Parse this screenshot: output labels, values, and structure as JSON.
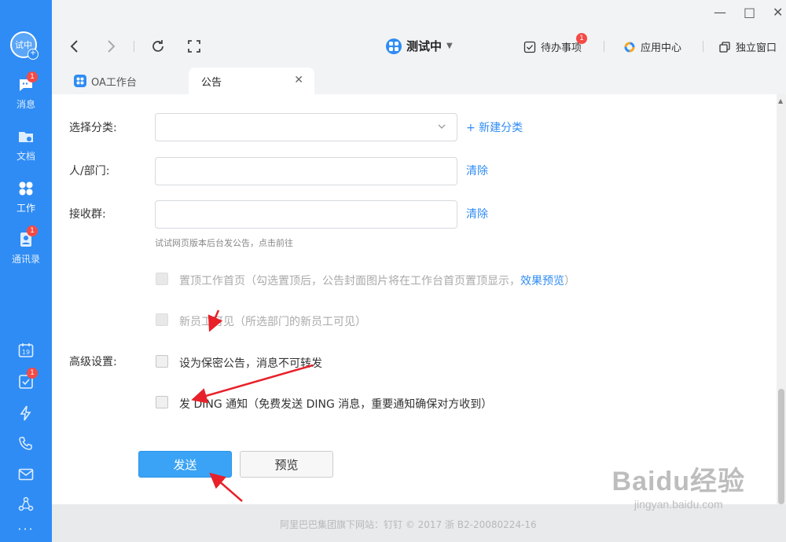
{
  "sidebar": {
    "avatar_text": "试中",
    "items": [
      {
        "label": "消息",
        "badge": "1"
      },
      {
        "label": "文档"
      },
      {
        "label": "工作"
      },
      {
        "label": "通讯录",
        "badge": "1"
      }
    ],
    "todo_badge": "1",
    "calendar_day": "19"
  },
  "topbar": {
    "org_name": "测试中",
    "todo_label": "待办事项",
    "todo_badge": "1",
    "app_center_label": "应用中心",
    "standalone_label": "独立窗口"
  },
  "tabs": [
    {
      "label": "OA工作台"
    },
    {
      "label": "公告"
    }
  ],
  "form": {
    "category_label": "选择分类:",
    "new_category_link": "+ 新建分类",
    "person_label": "人/部门:",
    "clear_link_1": "清除",
    "group_label": "接收群:",
    "clear_link_2": "清除",
    "hint": "试试网页版本后台发公告，点击前往",
    "pin_text": "置顶工作首页（勾选置顶后，公告封面图片将在工作台首页置顶显示，",
    "pin_link": "效果预览",
    "pin_close": "）",
    "newstaff_text": "新员工可见（所选部门的新员工可见）",
    "advanced_label": "高级设置:",
    "confidential_text": "设为保密公告，消息不可转发",
    "ding_text": "发 DING 通知（免费发送 DING 消息，重要通知确保对方收到）",
    "send_button": "发送",
    "preview_button": "预览"
  },
  "footer": {
    "text": "阿里巴巴集团旗下网站：钉钉 © 2017 浙 B2-20080224-16"
  },
  "watermark": {
    "logo": "Baidu经验",
    "url": "jingyan.baidu.com"
  },
  "colors": {
    "sidebar": "#2f8cf4",
    "link": "#2f8cf4",
    "send_button": "#3aa3f5",
    "badge": "#f54a45",
    "annotation_arrow": "#e8202a"
  }
}
